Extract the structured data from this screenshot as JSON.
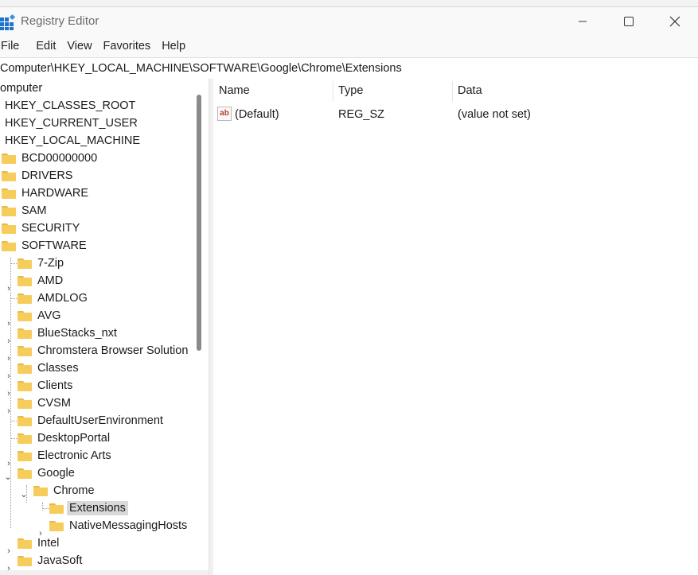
{
  "window": {
    "title": "Registry Editor",
    "buttons": {
      "minimize": "—",
      "maximize": "☐",
      "close": "✕"
    }
  },
  "menu": [
    "File",
    "Edit",
    "View",
    "Favorites",
    "Help"
  ],
  "address": "Computer\\HKEY_LOCAL_MACHINE\\SOFTWARE\\Google\\Chrome\\Extensions",
  "tree": {
    "root": "omputer",
    "hives": [
      "HKEY_CLASSES_ROOT",
      "HKEY_CURRENT_USER",
      "HKEY_LOCAL_MACHINE"
    ],
    "hklm_children": [
      "BCD00000000",
      "DRIVERS",
      "HARDWARE",
      "SAM",
      "SECURITY",
      "SOFTWARE"
    ],
    "software_children": [
      "7-Zip",
      "AMD",
      "AMDLOG",
      "AVG",
      "BlueStacks_nxt",
      "Chromstera Browser Solution",
      "Classes",
      "Clients",
      "CVSM",
      "DefaultUserEnvironment",
      "DesktopPortal",
      "Electronic Arts",
      "Google",
      "Intel",
      "JavaSoft"
    ],
    "google_children": [
      "Chrome"
    ],
    "chrome_children": [
      "Extensions",
      "NativeMessagingHosts"
    ],
    "selected": "Extensions"
  },
  "values": {
    "columns": [
      "Name",
      "Type",
      "Data"
    ],
    "rows": [
      {
        "name": "(Default)",
        "type": "REG_SZ",
        "data": "(value not set)",
        "icon": "ab-string-icon"
      }
    ]
  },
  "colors": {
    "folder": "#f6cc5a",
    "selection": "#d9d9d9",
    "icon_blue": "#1f73c9"
  }
}
